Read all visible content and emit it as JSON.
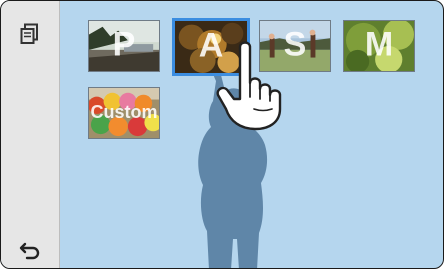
{
  "modes": [
    {
      "id": "p",
      "label": "P",
      "selected": false
    },
    {
      "id": "a",
      "label": "A",
      "selected": true
    },
    {
      "id": "s",
      "label": "S",
      "selected": false
    },
    {
      "id": "m",
      "label": "M",
      "selected": false
    },
    {
      "id": "custom",
      "label": "Custom",
      "selected": false
    }
  ],
  "colors": {
    "screen_bg": "#b5d6ee",
    "selected_border": "#3b8de0",
    "sidebar_bg": "#e6e6e6",
    "silhouette": "#5f86a8"
  },
  "icons": {
    "mode_switch": "mode-switch-icon",
    "back": "back-arrow-icon",
    "touch": "tap-hand-icon"
  }
}
